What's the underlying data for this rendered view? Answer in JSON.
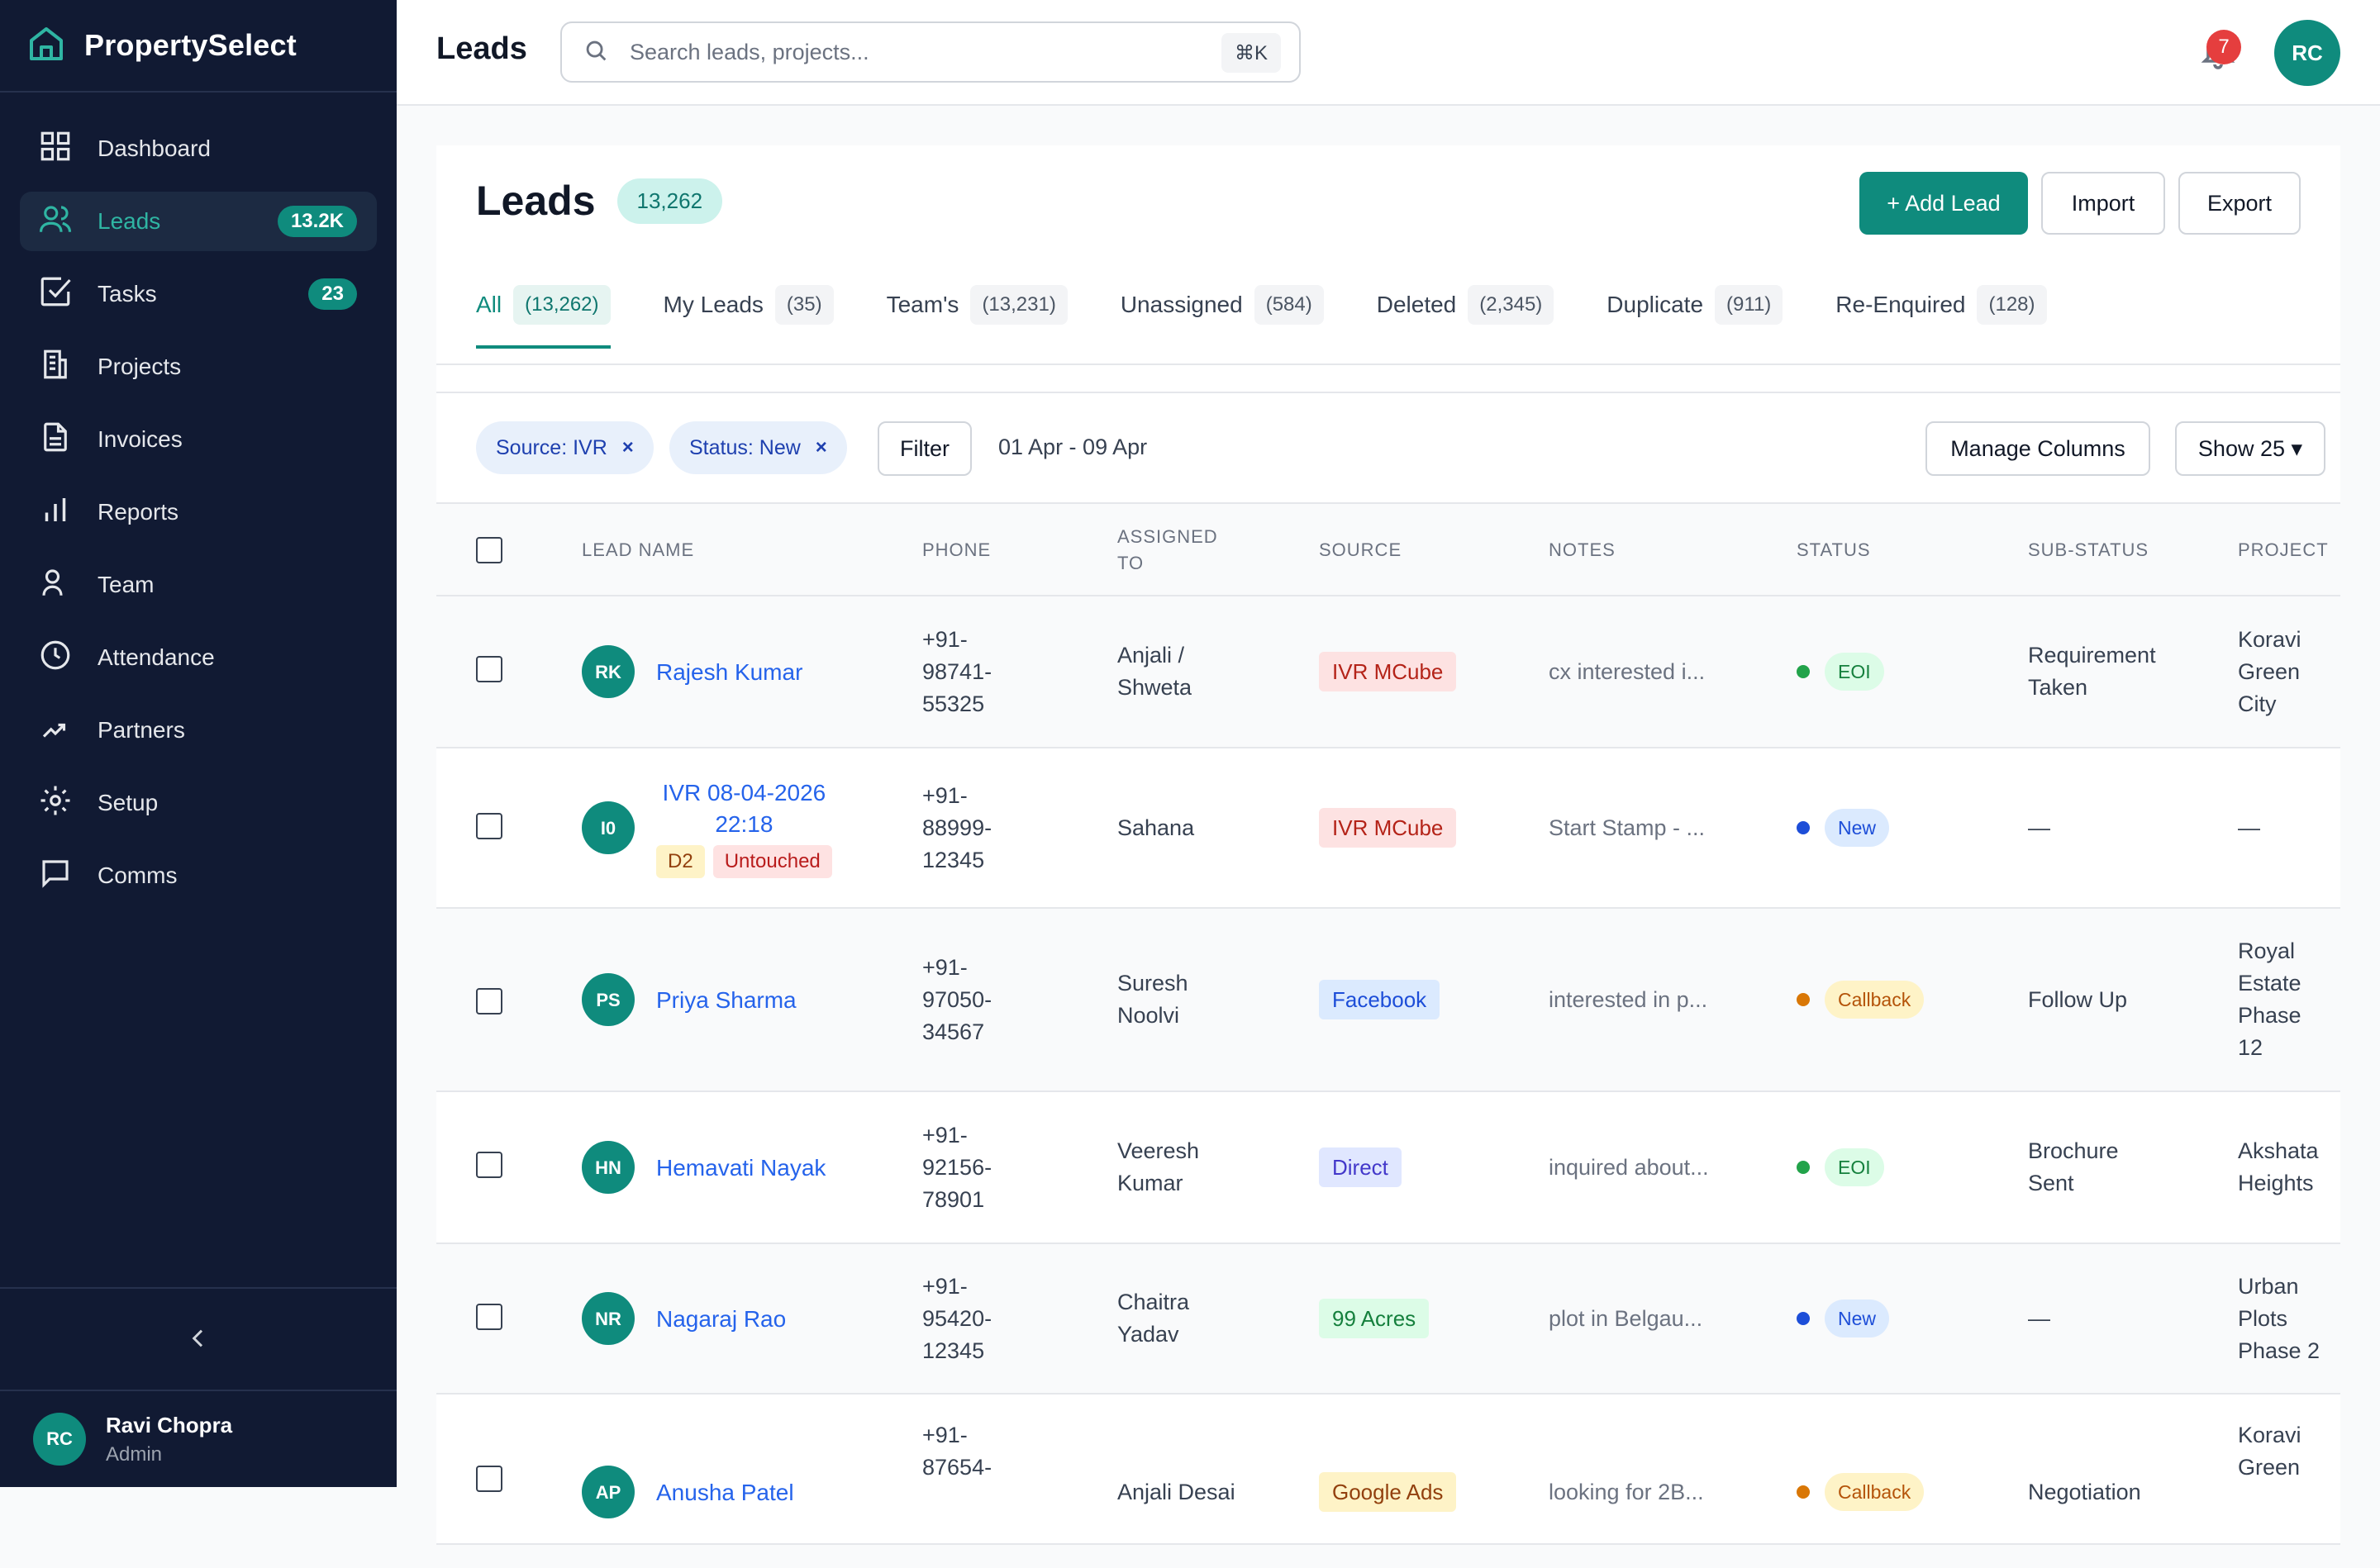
{
  "app": {
    "brand": "PropertySelect"
  },
  "sidebar": {
    "items": [
      {
        "label": "Dashboard",
        "icon": "grid-icon",
        "badge": ""
      },
      {
        "label": "Leads",
        "icon": "users-icon",
        "badge": "13.2K",
        "active": true
      },
      {
        "label": "Tasks",
        "icon": "check-square-icon",
        "badge": "23"
      },
      {
        "label": "Projects",
        "icon": "building-icon",
        "badge": ""
      },
      {
        "label": "Invoices",
        "icon": "file-text-icon",
        "badge": ""
      },
      {
        "label": "Reports",
        "icon": "bar-chart-icon",
        "badge": ""
      },
      {
        "label": "Team",
        "icon": "user-icon",
        "badge": ""
      },
      {
        "label": "Attendance",
        "icon": "clock-icon",
        "badge": ""
      },
      {
        "label": "Partners",
        "icon": "handshake-icon",
        "badge": ""
      },
      {
        "label": "Setup",
        "icon": "gear-icon",
        "badge": ""
      },
      {
        "label": "Comms",
        "icon": "message-icon",
        "badge": ""
      }
    ],
    "user": {
      "initials": "RC",
      "name": "Ravi Chopra",
      "role": "Admin"
    }
  },
  "topbar": {
    "title": "Leads",
    "search_placeholder": "Search leads, projects...",
    "shortcut": "⌘K",
    "notifications": "7",
    "avatar": "RC"
  },
  "page": {
    "title": "Leads",
    "count": "13,262",
    "add_label": "+ Add Lead",
    "import_label": "Import",
    "export_label": "Export"
  },
  "tabs": [
    {
      "label": "All",
      "count": "(13,262)",
      "active": true
    },
    {
      "label": "My Leads",
      "count": "(35)"
    },
    {
      "label": "Team's",
      "count": "(13,231)"
    },
    {
      "label": "Unassigned",
      "count": "(584)"
    },
    {
      "label": "Deleted",
      "count": "(2,345)"
    },
    {
      "label": "Duplicate",
      "count": "(911)"
    },
    {
      "label": "Re-Enquired",
      "count": "(128)"
    }
  ],
  "filters": {
    "chips": [
      {
        "label": "Source: IVR",
        "remove": "×"
      },
      {
        "label": "Status: New",
        "remove": "×"
      }
    ],
    "filter_label": "Filter",
    "date_range": "01 Apr - 09 Apr",
    "manage_columns": "Manage Columns",
    "show": "Show 25 ▾"
  },
  "table": {
    "columns": [
      "LEAD NAME",
      "PHONE",
      "ASSIGNED\nTO",
      "SOURCE",
      "NOTES",
      "STATUS",
      "SUB-STATUS",
      "PROJECT"
    ],
    "rows": [
      {
        "initials": "RK",
        "name": "Rajesh Kumar",
        "phone": "+91-\n98741-\n55325",
        "assigned": "Anjali /\nShweta",
        "source": "IVR MCube",
        "notes": "cx interested i...",
        "status": "EOI",
        "sub_status": "Requirement\nTaken",
        "project": "Koravi\nGreen\nCity"
      },
      {
        "initials": "I0",
        "name": "IVR 08-04-2026\n22:18",
        "tag1": "D2",
        "tag2": "Untouched",
        "phone": "+91-\n88999-\n12345",
        "assigned": "Sahana",
        "source": "IVR MCube",
        "notes": "Start Stamp - ...",
        "status": "New",
        "sub_status": "—",
        "project": "—"
      },
      {
        "initials": "PS",
        "name": "Priya Sharma",
        "phone": "+91-\n97050-\n34567",
        "assigned": "Suresh\nNoolvi",
        "source": "Facebook",
        "notes": "interested in p...",
        "status": "Callback",
        "sub_status": "Follow Up",
        "project": "Royal\nEstate\nPhase\n12"
      },
      {
        "initials": "HN",
        "name": "Hemavati Nayak",
        "phone": "+91-\n92156-\n78901",
        "assigned": "Veeresh\nKumar",
        "source": "Direct",
        "notes": "inquired about...",
        "status": "EOI",
        "sub_status": "Brochure\nSent",
        "project": "Akshata\nHeights"
      },
      {
        "initials": "NR",
        "name": "Nagaraj Rao",
        "phone": "+91-\n95420-\n12345",
        "assigned": "Chaitra\nYadav",
        "source": "99 Acres",
        "notes": "plot in Belgau...",
        "status": "New",
        "sub_status": "—",
        "project": "Urban\nPlots\nPhase 2"
      },
      {
        "initials": "AP",
        "name": "Anusha Patel",
        "phone": "+91-\n87654-",
        "assigned": "Anjali Desai",
        "source": "Google Ads",
        "notes": "looking for 2B...",
        "status": "Callback",
        "sub_status": "Negotiation",
        "project": "Koravi\nGreen"
      }
    ]
  },
  "colors": {
    "brand": "#0f8b7d",
    "sidebar_bg": "#111a33",
    "link": "#2563eb",
    "status_eoi": "#22a34a",
    "status_new": "#1d4ed8",
    "status_callback": "#d97706"
  }
}
